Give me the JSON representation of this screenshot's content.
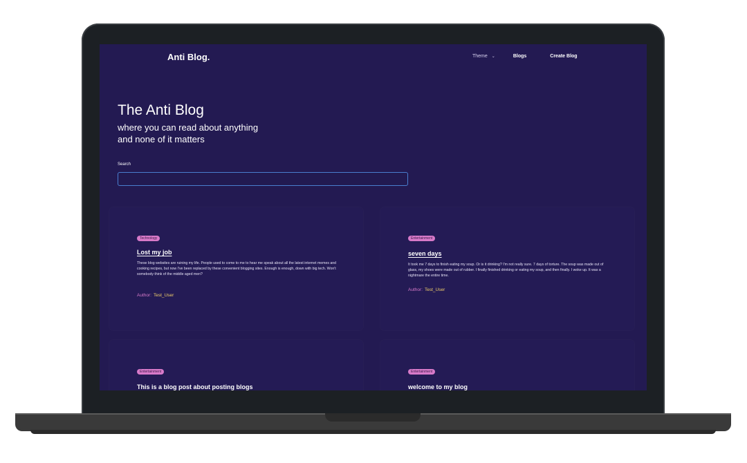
{
  "header": {
    "brand": "Anti Blog.",
    "nav": {
      "theme": "Theme",
      "blogs": "Blogs",
      "create": "Create Blog"
    }
  },
  "hero": {
    "title": "The Anti Blog",
    "subtitle_line1": "where you can read about anything",
    "subtitle_line2": "and none of it matters"
  },
  "search": {
    "label": "Search",
    "value": "",
    "placeholder": ""
  },
  "author_label": "Author:",
  "posts": [
    {
      "category": "Technology",
      "title": "Lost my job",
      "excerpt": "These blog websites are ruining my life. People used to come to me to hear me speak about all the latest internet memes and cooking recipes, but now I've been replaced by these convenient blogging sites. Enough is enough, down with big tech. Won't somebody think of the middle aged men?",
      "author": "Test_User"
    },
    {
      "category": "Entertainment",
      "title": "seven days",
      "excerpt": "It took me 7 days to finish eating my soup. Or is it drinking? I'm not really sure. 7 days of torture. The soup was made out of glass, my shoes were made out of rubber. I finally finished drinking or eating my soup, and then finally. I woke up. It was a nightmare the entire time.",
      "author": "Test_User"
    },
    {
      "category": "Entertainment",
      "title": "This is a blog post about posting blogs"
    },
    {
      "category": "Entertainment",
      "title": "welcome to my blog"
    }
  ],
  "colors": {
    "background": "#231a52",
    "card": "#241b55",
    "badge": "#d77ac9",
    "author_name": "#f3d06a",
    "search_border": "#4a7fd0"
  }
}
